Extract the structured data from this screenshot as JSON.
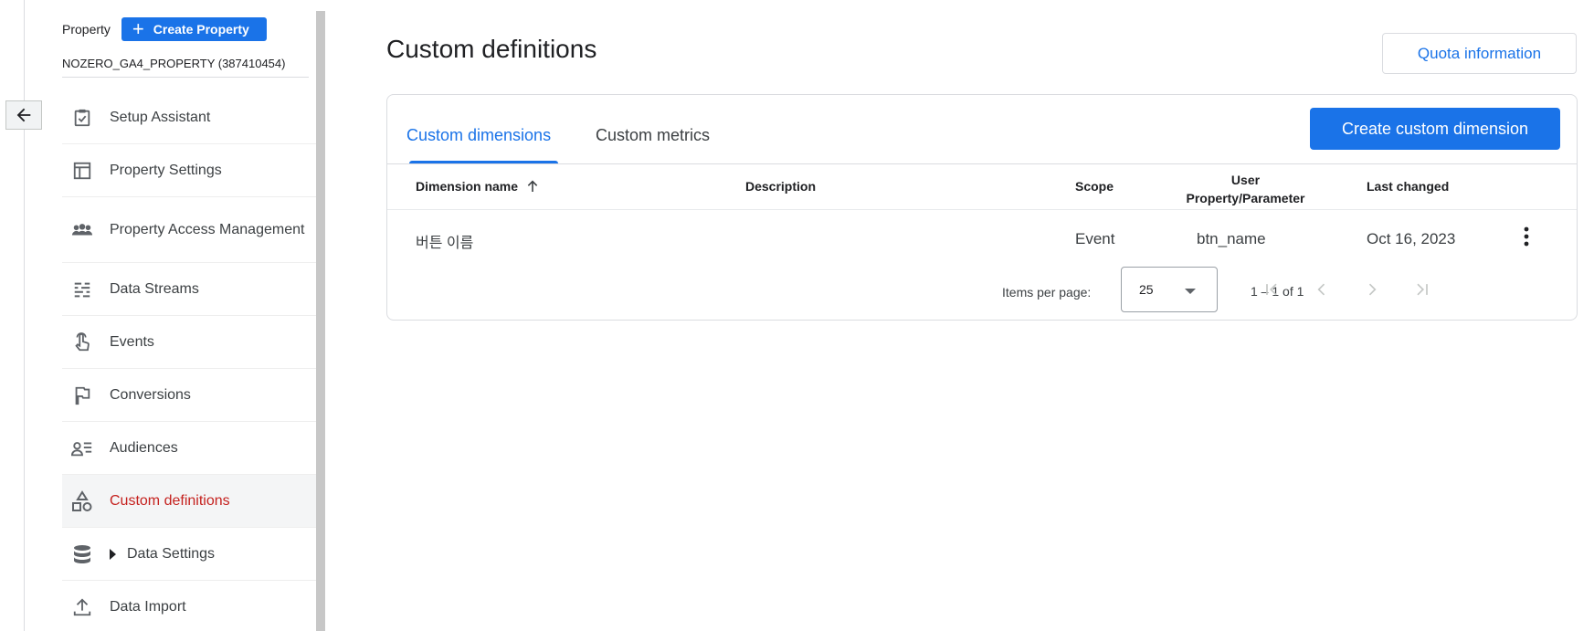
{
  "sidebar": {
    "property_label": "Property",
    "create_property_label": "Create Property",
    "property_name": "NOZERO_GA4_PROPERTY (387410454)",
    "items": [
      {
        "label": "Setup Assistant",
        "icon": "clipboard-check-icon"
      },
      {
        "label": "Property Settings",
        "icon": "layout-icon"
      },
      {
        "label": "Property Access Management",
        "icon": "group-icon"
      },
      {
        "label": "Data Streams",
        "icon": "streams-icon"
      },
      {
        "label": "Events",
        "icon": "touch-icon"
      },
      {
        "label": "Conversions",
        "icon": "flag-icon"
      },
      {
        "label": "Audiences",
        "icon": "audience-icon"
      },
      {
        "label": "Custom definitions",
        "icon": "shapes-icon",
        "active": true
      },
      {
        "label": "Data Settings",
        "icon": "database-icon"
      },
      {
        "label": "Data Import",
        "icon": "upload-icon"
      }
    ]
  },
  "main": {
    "title": "Custom definitions",
    "quota_button": "Quota information",
    "tabs": [
      {
        "label": "Custom dimensions",
        "active": true
      },
      {
        "label": "Custom metrics",
        "active": false
      }
    ],
    "create_button": "Create custom dimension",
    "table": {
      "headers": {
        "name": "Dimension name",
        "description": "Description",
        "scope": "Scope",
        "user_param": "User Property/Parameter",
        "last_changed": "Last changed"
      },
      "rows": [
        {
          "name": "버튼 이름",
          "description": "",
          "scope": "Event",
          "user_param": "btn_name",
          "last_changed": "Oct 16, 2023"
        }
      ]
    },
    "pagination": {
      "items_per_page_label": "Items per page:",
      "items_per_page": "25",
      "range": "1 – 1 of 1"
    }
  },
  "colors": {
    "accent": "#1a73e8",
    "active_nav_text": "#c5221f"
  }
}
